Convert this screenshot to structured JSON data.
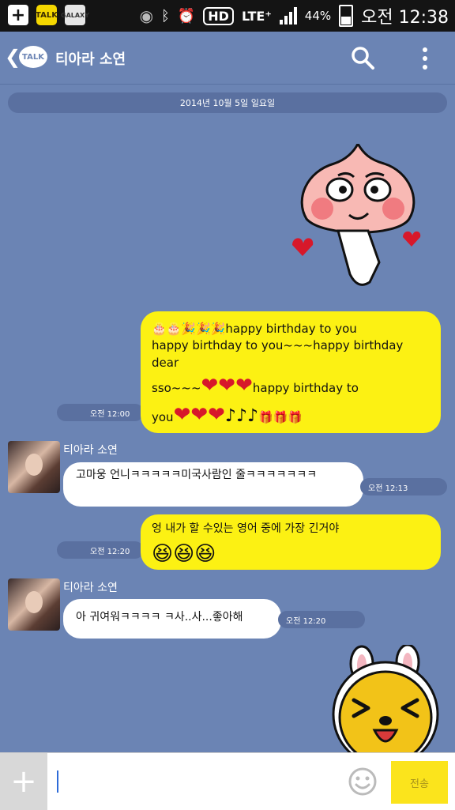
{
  "status_bar": {
    "talk_icon": "TALK",
    "galaxy_icon": "GALAXY",
    "hd_badge": "HD",
    "network": "LTE⁺",
    "battery": "44%",
    "time": "오전 12:38"
  },
  "header": {
    "logo_text": "TALK",
    "title": "티아라 소연"
  },
  "date_divider": "2014년 10월 5일 일요일",
  "messages": {
    "m1": {
      "text_1": "happy birthday to you",
      "text_2": "happy birthday to you~~~happy birthday dear",
      "text_3": "sso~~~",
      "text_4": "happy birthday to",
      "text_5": "you",
      "time": "오전 12:00"
    },
    "m2": {
      "sender": "티아라 소연",
      "text": "고마웅 언니ㅋㅋㅋㅋㅋ미국사람인 줄ㅋㅋㅋㅋㅋㅋㅋ",
      "time": "오전 12:13"
    },
    "m3": {
      "text": "엉 내가 할 수있는 영어 중에 가장 긴거야",
      "time": "오전 12:20"
    },
    "m4": {
      "sender": "티아라 소연",
      "text": "아 귀여워ㅋㅋㅋㅋ ㅋ사..사...좋아해",
      "time": "오전 12:20"
    }
  },
  "input": {
    "send_label": "전송"
  },
  "colors": {
    "chat_background": "#6b84b4",
    "my_bubble": "#fcf113",
    "friend_bubble": "#ffffff",
    "send_button": "#fbe41c"
  }
}
